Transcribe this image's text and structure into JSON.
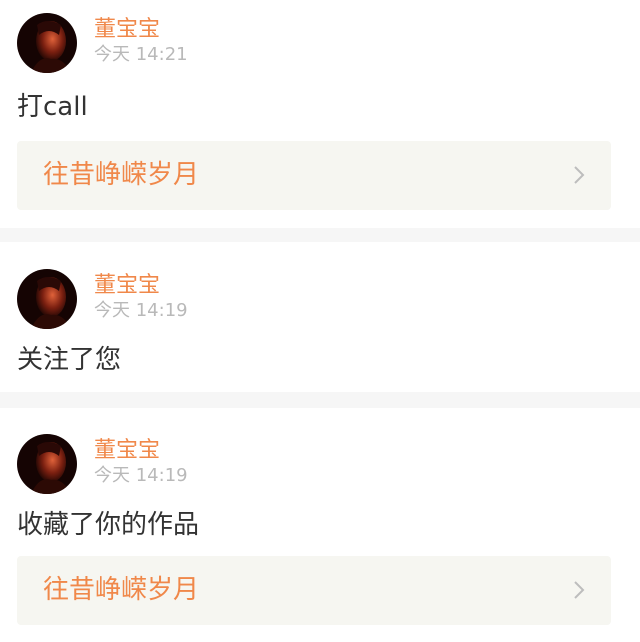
{
  "colors": {
    "accent": "#f0884a",
    "text": "#333333",
    "muted": "#b9b9b9",
    "separator": "#f6f6f6",
    "card_bg": "#f6f6f1",
    "chevron": "#bdbdbd"
  },
  "notifications": [
    {
      "user": "董宝宝",
      "time": "今天 14:21",
      "message": "打call",
      "avatar_icon": "user-avatar-icon",
      "work": {
        "title": "往昔峥嵘岁月",
        "icon": "chevron-right-icon"
      }
    },
    {
      "user": "董宝宝",
      "time": "今天 14:19",
      "message": "关注了您",
      "avatar_icon": "user-avatar-icon"
    },
    {
      "user": "董宝宝",
      "time": "今天 14:19",
      "message": "收藏了你的作品",
      "avatar_icon": "user-avatar-icon",
      "work": {
        "title": "往昔峥嵘岁月",
        "icon": "chevron-right-icon"
      }
    }
  ]
}
